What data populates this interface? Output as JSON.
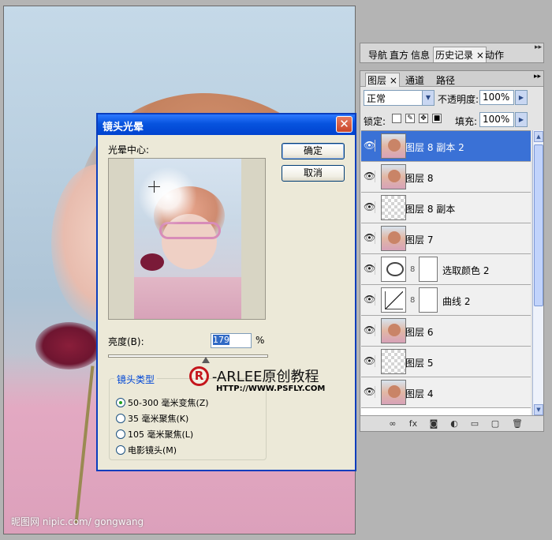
{
  "watermark": "昵图网 nipic.com/ gongwang",
  "dialog": {
    "title": "镜头光晕",
    "close_label": "✕",
    "flare_center_label": "光晕中心:",
    "ok_label": "确定",
    "cancel_label": "取消",
    "brightness_label": "亮度(B):",
    "brightness_value": "179",
    "brightness_unit": "%",
    "brightness_slider_position": 0.61,
    "lens_type_label": "镜头类型",
    "lens_options": [
      {
        "label": "50-300 毫米变焦(Z)",
        "selected": true
      },
      {
        "label": "35 毫米聚焦(K)",
        "selected": false
      },
      {
        "label": "105 毫米聚焦(L)",
        "selected": false
      },
      {
        "label": "电影镜头(M)",
        "selected": false
      }
    ]
  },
  "brand": {
    "mark": "R",
    "name": "-ARLEE原创教程",
    "url": "HTTP://WWW.PSFLY.COM"
  },
  "top_panel": {
    "tabs": [
      "导航",
      "直方",
      "信息",
      "历史记录",
      "×",
      "动作"
    ],
    "active_tab": "历史记录",
    "controls": "▸▸"
  },
  "layers_panel": {
    "tabs": [
      "图层",
      "×",
      "通道",
      "路径"
    ],
    "active_tab": "图层",
    "blend_mode": "正常",
    "opacity_label": "不透明度:",
    "opacity_value": "100%",
    "lock_label": "锁定:",
    "fill_label": "填充:",
    "fill_value": "100%",
    "layers": [
      {
        "name": "图层 8 副本 2",
        "thumb": "photo",
        "visible": true,
        "selected": true
      },
      {
        "name": "图层 8",
        "thumb": "photo",
        "visible": true,
        "selected": false
      },
      {
        "name": "图层 8 副本",
        "thumb": "transparent",
        "visible": true,
        "selected": false
      },
      {
        "name": "图层 7",
        "thumb": "photo",
        "visible": true,
        "selected": false
      },
      {
        "name": "选取颜色 2",
        "thumb": "adjustment",
        "visible": true,
        "selected": false,
        "mask": true
      },
      {
        "name": "曲线 2",
        "thumb": "curves",
        "visible": true,
        "selected": false,
        "mask": true
      },
      {
        "name": "图层 6",
        "thumb": "photo",
        "visible": true,
        "selected": false
      },
      {
        "name": "图层 5",
        "thumb": "transparent",
        "visible": true,
        "selected": false
      },
      {
        "name": "图层 4",
        "thumb": "photo",
        "visible": true,
        "selected": false
      }
    ],
    "footer_icons": [
      "link-icon",
      "fx-icon",
      "mask-icon",
      "adjustment-icon",
      "folder-icon",
      "new-layer-icon",
      "trash-icon"
    ],
    "footer_glyphs": [
      "∞",
      "fx",
      "◙",
      "◐",
      "▭",
      "▢",
      "🗑"
    ]
  }
}
